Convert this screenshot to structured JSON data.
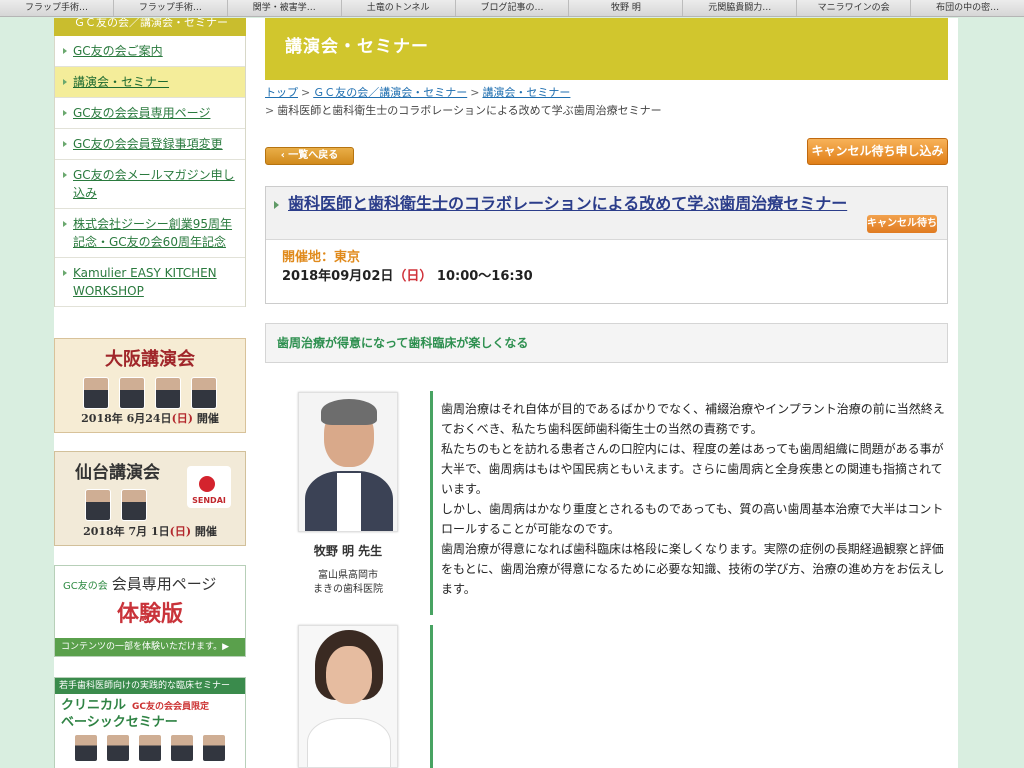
{
  "bookmarks": [
    "フラップ手術…",
    "フラップ手術…",
    "関学・被害学…",
    "土竜のトンネル",
    "ブログ記事の…",
    "牧野 明",
    "元関脇貴闘力…",
    "マニラワインの会",
    "布団の中の密…"
  ],
  "sidebar": {
    "heading": "ＧＣ友の会／講演会・セミナー",
    "items": [
      {
        "label": "GC友の会ご案内"
      },
      {
        "label": "講演会・セミナー"
      },
      {
        "label": "GC友の会会員専用ページ"
      },
      {
        "label": "GC友の会会員登録事項変更"
      },
      {
        "label": "GC友の会メールマガジン申し込み"
      },
      {
        "label": "株式会社ジーシー創業95周年記念・GC友の会60周年記念"
      },
      {
        "label": "Kamulier EASY KITCHEN WORKSHOP"
      }
    ],
    "active_index": 1
  },
  "banners": {
    "osaka": {
      "title": "大阪講演会",
      "date_pre": "2018年 6月24日",
      "dow": "(日)",
      "date_post": " 開催"
    },
    "sendai": {
      "title": "仙台講演会",
      "tag": "SENDAI",
      "date_pre": "2018年 7月 1日",
      "dow": "(日)",
      "date_post": " 開催"
    },
    "member": {
      "logo": "GC友の会",
      "title": "会員専用ページ",
      "trial": "体験版",
      "footer": "コンテンツの一部を体験いただけます。▶"
    },
    "clinical": {
      "top": "若手歯科医師向けの実践的な臨床セミナー",
      "line1": "クリニカル",
      "limited": "GC友の会会員限定",
      "line2": "ベーシックセミナー"
    }
  },
  "main": {
    "page_title": "講演会・セミナー",
    "breadcrumb": {
      "links": [
        "トップ",
        "ＧＣ友の会／講演会・セミナー",
        "講演会・セミナー"
      ],
      "current": "歯科医師と歯科衛生士のコラボレーションによる改めて学ぶ歯周治療セミナー"
    },
    "back_button": "‹ 一覧へ戻る",
    "cancel_button": "キャンセル待ち申し込み",
    "event": {
      "title": "歯科医師と歯科衛生士のコラボレーションによる改めて学ぶ歯周治療セミナー",
      "status": "キャンセル待ち",
      "venue": "開催地：東京",
      "date": "2018年09月02日",
      "dow": "（日）",
      "time": "10:00〜16:30"
    },
    "tagline": "歯周治療が得意になって歯科臨床が楽しくなる",
    "speaker": {
      "name": "牧野 明 先生",
      "pref": "富山県高岡市",
      "clinic": "まきの歯科医院"
    },
    "description": [
      "歯周治療はそれ自体が目的であるばかりでなく、補綴治療やインプラント治療の前に当然終えておくべき、私たち歯科医師歯科衛生士の当然の責務です。",
      "私たちのもとを訪れる患者さんの口腔内には、程度の差はあっても歯周組織に問題がある事が大半で、歯周病はもはや国民病ともいえます。さらに歯周病と全身疾患との関連も指摘されています。",
      "しかし、歯周病はかなり重度とされるものであっても、質の高い歯周基本治療で大半はコントロールすることが可能なのです。",
      "歯周治療が得意になれば歯科臨床は格段に楽しくなります。実際の症例の長期経過観察と評価をもとに、歯周治療が得意になるために必要な知識、技術の学び方、治療の進め方をお伝えします。"
    ]
  }
}
